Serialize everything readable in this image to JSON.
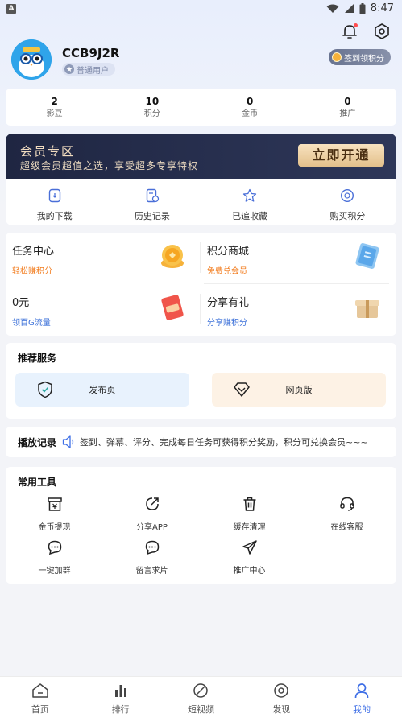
{
  "status_bar": {
    "time": "8:47",
    "app_letter": "A"
  },
  "profile": {
    "username": "CCB9J2R",
    "level": "普通用户",
    "checkin_label": "签到领积分"
  },
  "stats": [
    {
      "value": "2",
      "label": "影豆"
    },
    {
      "value": "10",
      "label": "积分"
    },
    {
      "value": "0",
      "label": "金币"
    },
    {
      "value": "0",
      "label": "推广"
    }
  ],
  "vip": {
    "title": "会员专区",
    "desc": "超级会员超值之选，享受超多专享特权",
    "button": "立即开通"
  },
  "quick_actions": [
    {
      "label": "我的下载",
      "icon": "download-icon"
    },
    {
      "label": "历史记录",
      "icon": "history-icon"
    },
    {
      "label": "已追收藏",
      "icon": "star-icon"
    },
    {
      "label": "购买积分",
      "icon": "coin-icon"
    }
  ],
  "tasks": [
    {
      "title": "任务中心",
      "subtitle": "轻松赚积分",
      "color": "#f27a1a"
    },
    {
      "title": "积分商城",
      "subtitle": "免费兑会员",
      "color": "#f27a1a"
    },
    {
      "title": "0元",
      "subtitle": "领百G流量",
      "color": "#3a6fd8"
    },
    {
      "title": "分享有礼",
      "subtitle": "分享赚积分",
      "color": "#3a6fd8"
    }
  ],
  "services": {
    "title": "推荐服务",
    "items": [
      {
        "label": "发布页"
      },
      {
        "label": "网页版"
      }
    ]
  },
  "play_record": {
    "title": "播放记录",
    "text": "签到、弹幕、评分、完成每日任务可获得积分奖励，积分可兑换会员~~~"
  },
  "tools": {
    "title": "常用工具",
    "items": [
      {
        "label": "金币提现",
        "icon": "wallet-icon"
      },
      {
        "label": "分享APP",
        "icon": "share-icon"
      },
      {
        "label": "缓存清理",
        "icon": "trash-icon"
      },
      {
        "label": "在线客服",
        "icon": "headset-icon"
      },
      {
        "label": "一键加群",
        "icon": "group-chat-icon"
      },
      {
        "label": "留言求片",
        "icon": "message-icon"
      },
      {
        "label": "推广中心",
        "icon": "send-icon"
      }
    ]
  },
  "tabs": [
    {
      "label": "首页",
      "icon": "home-icon"
    },
    {
      "label": "排行",
      "icon": "ranking-icon"
    },
    {
      "label": "短视频",
      "icon": "short-video-icon"
    },
    {
      "label": "发现",
      "icon": "discover-icon"
    },
    {
      "label": "我的",
      "icon": "profile-icon",
      "active": true
    }
  ],
  "colors": {
    "accent": "#3f6fe6",
    "vip_gold": "#e3c08b",
    "vip_dark": "#1f2642"
  }
}
